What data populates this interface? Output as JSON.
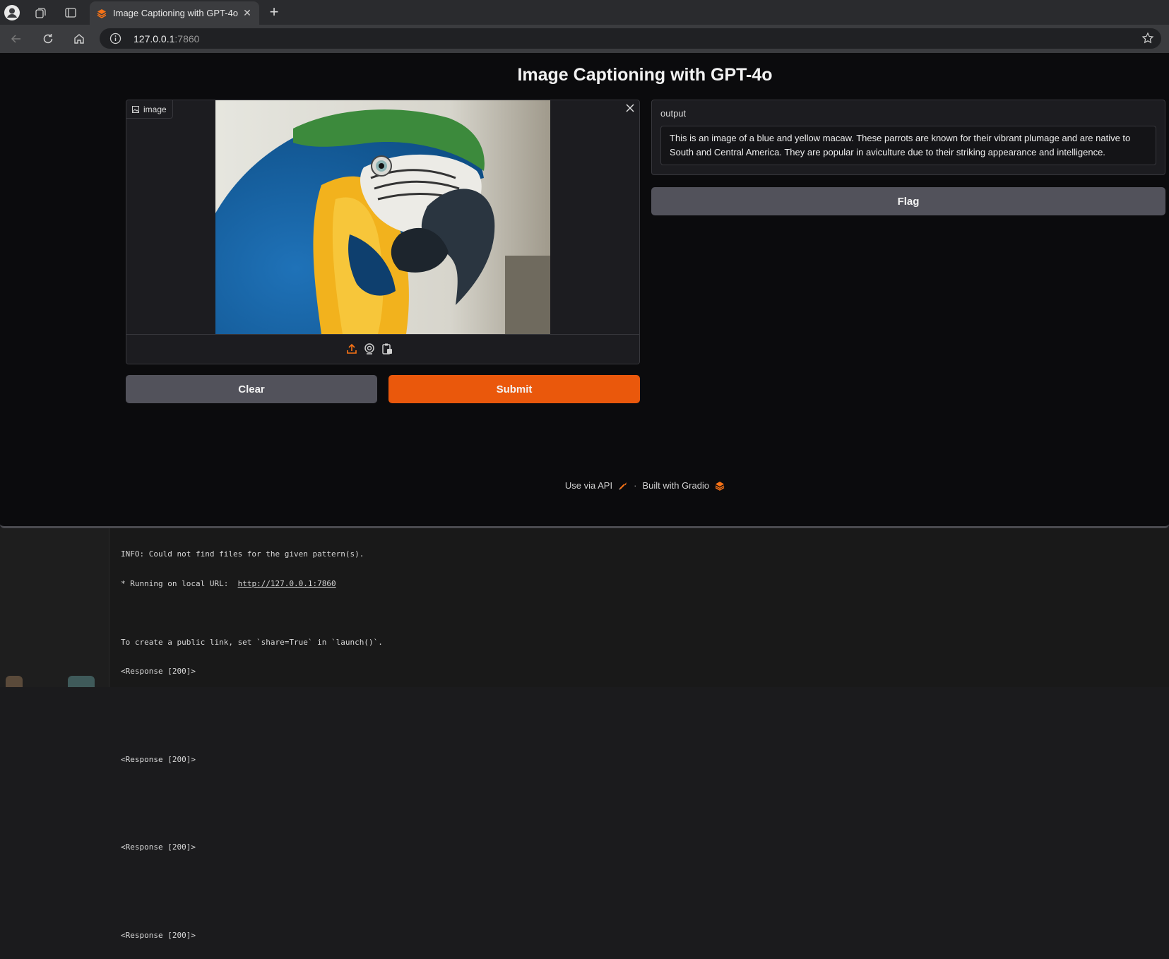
{
  "browser": {
    "tab_title": "Image Captioning with GPT-4o",
    "address_host": "127.0.0.1",
    "address_port": ":7860",
    "icons": [
      "profile-icon",
      "collections-icon",
      "tab-actions-icon",
      "close-icon",
      "new-tab-icon",
      "back-icon",
      "refresh-icon",
      "home-icon",
      "info-icon",
      "favorite-star-icon"
    ]
  },
  "app": {
    "title": "Image Captioning with GPT-4o",
    "image_input": {
      "label": "image",
      "tools": [
        "upload-icon",
        "webcam-icon",
        "clipboard-icon"
      ]
    },
    "buttons": {
      "clear": "Clear",
      "submit": "Submit",
      "flag": "Flag"
    },
    "output": {
      "label": "output",
      "text": "This is an image of a blue and yellow macaw. These parrots are known for their vibrant plumage and are native to South and Central America. They are popular in aviculture due to their striking appearance and intelligence."
    },
    "footer": {
      "api": "Use via API",
      "separator": "·",
      "built": "Built with Gradio"
    },
    "colors": {
      "accent": "#ea580c",
      "secondary_button": "#52525b",
      "background": "#0b0b0d"
    }
  },
  "terminal": {
    "lines": [
      "INFO: Could not find files for the given pattern(s).",
      "* Running on local URL:  ",
      "",
      "To create a public link, set `share=True` in `launch()`.",
      "<Response [200]>",
      "",
      "",
      "<Response [200]>",
      "",
      "",
      "<Response [200]>",
      "",
      "",
      "<Response [200]>"
    ],
    "url": "http://127.0.0.1:7860"
  }
}
